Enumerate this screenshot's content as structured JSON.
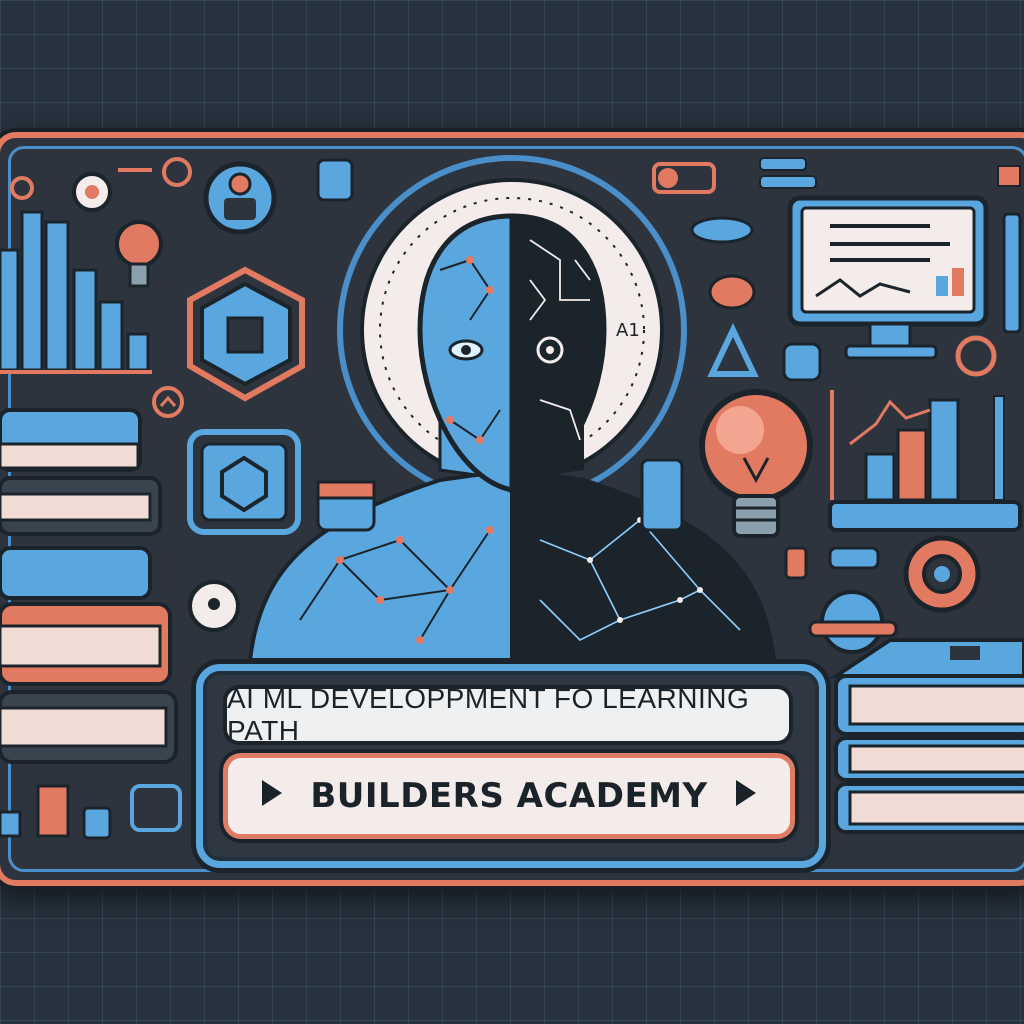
{
  "header_label": "AI ML DEVELOPPMENT FO LEARNING PATH",
  "title": "BUILDERS ACADEMY",
  "head_label": "A1",
  "icons": {
    "play_left": "play-icon",
    "play_right": "play-icon",
    "bulb": "lightbulb-icon",
    "gear": "gear-icon",
    "monitor": "monitor-chart-icon",
    "books": "books-icon"
  },
  "colors": {
    "accent_blue": "#5aa6de",
    "accent_coral": "#e27a62",
    "dark": "#2d343d",
    "background": "#26323d"
  }
}
